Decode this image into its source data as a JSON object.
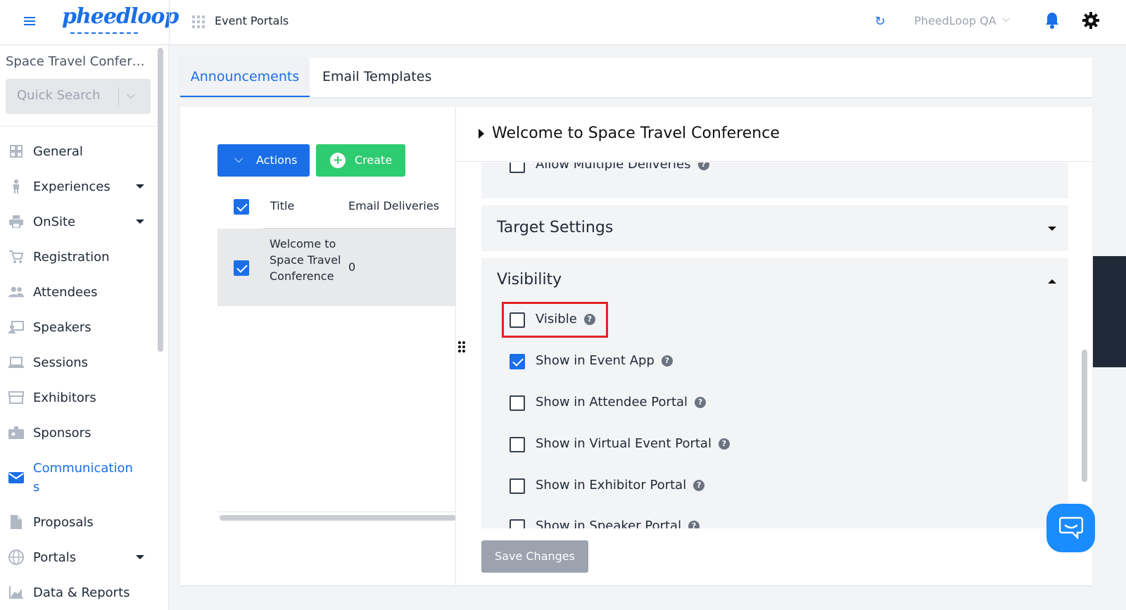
{
  "topbar": {
    "logo_text": "pheedloop",
    "app_section": "Event Portals",
    "org_name": "PheedLoop QA",
    "icons": [
      "hamburger-icon",
      "grid-icon",
      "refresh-icon",
      "chevron-down-icon",
      "bell-icon",
      "gear-icon"
    ]
  },
  "sidebar": {
    "event_name": "Space Travel Confer…",
    "quick_search_placeholder": "Quick Search",
    "items": [
      {
        "label": "General",
        "icon": "dashboard-icon"
      },
      {
        "label": "Experiences",
        "icon": "person-icon",
        "expandable": true
      },
      {
        "label": "OnSite",
        "icon": "printer-icon",
        "expandable": true
      },
      {
        "label": "Registration",
        "icon": "cart-icon"
      },
      {
        "label": "Attendees",
        "icon": "people-icon"
      },
      {
        "label": "Speakers",
        "icon": "presenter-icon"
      },
      {
        "label": "Sessions",
        "icon": "laptop-icon"
      },
      {
        "label": "Exhibitors",
        "icon": "storefront-icon"
      },
      {
        "label": "Sponsors",
        "icon": "badge-icon"
      },
      {
        "label": "Communication\ns",
        "icon": "mail-icon",
        "active": true
      },
      {
        "label": "Proposals",
        "icon": "document-icon"
      },
      {
        "label": "Portals",
        "icon": "globe-icon",
        "expandable": true
      },
      {
        "label": "Data & Reports",
        "icon": "chart-icon"
      }
    ]
  },
  "tabs": [
    {
      "label": "Announcements",
      "active": true
    },
    {
      "label": "Email Templates",
      "active": false
    }
  ],
  "list": {
    "actions_label": "Actions",
    "create_label": "Create",
    "columns": [
      "Title",
      "Email Deliveries"
    ],
    "rows": [
      {
        "title": "Welcome to Space Travel Conference",
        "email_deliveries": "0",
        "checked": true
      }
    ],
    "header_checked": true
  },
  "detail": {
    "title": "Welcome to Space Travel Conference",
    "partial_option": "Allow Multiple Deliveries",
    "target_settings_label": "Target Settings",
    "visibility_label": "Visibility",
    "visibility_options": [
      {
        "label": "Visible",
        "checked": false
      },
      {
        "label": "Show in Event App",
        "checked": true
      },
      {
        "label": "Show in Attendee Portal",
        "checked": false
      },
      {
        "label": "Show in Virtual Event Portal",
        "checked": false
      },
      {
        "label": "Show in Exhibitor Portal",
        "checked": false
      },
      {
        "label": "Show in Speaker Portal",
        "checked": false
      }
    ],
    "save_label": "Save Changes",
    "help_glyph": "?"
  },
  "colors": {
    "accent": "#1a6fe8",
    "create_green": "#2ecc71",
    "highlight_red": "#e02424",
    "chat_blue": "#1a8cff"
  }
}
